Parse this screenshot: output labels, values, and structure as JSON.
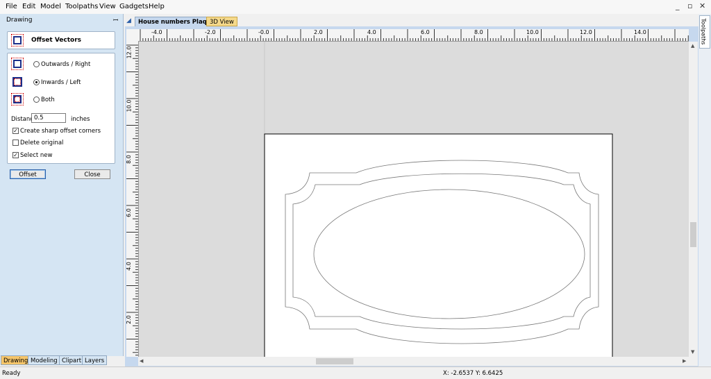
{
  "menu": [
    "File",
    "Edit",
    "Model",
    "Toolpaths",
    "View",
    "Gadgets",
    "Help"
  ],
  "window_controls": {
    "minimize": "_",
    "restore": "▫",
    "close": "✕"
  },
  "panel": {
    "title": "Drawing",
    "pin_glyph": "ꟷ",
    "tool_title": "Offset Vectors",
    "options": [
      {
        "label": "Outwards / Right",
        "selected": false
      },
      {
        "label": "Inwards / Left",
        "selected": true
      },
      {
        "label": "Both",
        "selected": false
      }
    ],
    "distance_label": "Distance:",
    "distance_value": "0.5",
    "distance_unit": "inches",
    "checks": [
      {
        "label": "Create sharp offset corners",
        "checked": true
      },
      {
        "label": "Delete original",
        "checked": false
      },
      {
        "label": "Select new",
        "checked": true
      }
    ],
    "offset_button": "Offset",
    "close_button": "Close"
  },
  "bottom_tabs": [
    "Drawing",
    "Modeling",
    "Clipart",
    "Layers"
  ],
  "doc_tabs": [
    "House numbers Plaque",
    "3D View"
  ],
  "right_strip_label": "Toolpaths",
  "ruler_top": [
    "-4.0",
    "-2.0",
    "-0.0",
    "2.0",
    "4.0",
    "6.0",
    "8.0",
    "10.0",
    "12.0",
    "14.0"
  ],
  "ruler_left": [
    "12.0",
    "10.0",
    "8.0",
    "6.0",
    "4.0",
    "2.0"
  ],
  "scroll": {
    "up": "▲",
    "down": "▼",
    "left": "◀",
    "right": "▶"
  },
  "status": {
    "text": "Ready",
    "coords": "X: -2.6537 Y:  6.6425"
  }
}
